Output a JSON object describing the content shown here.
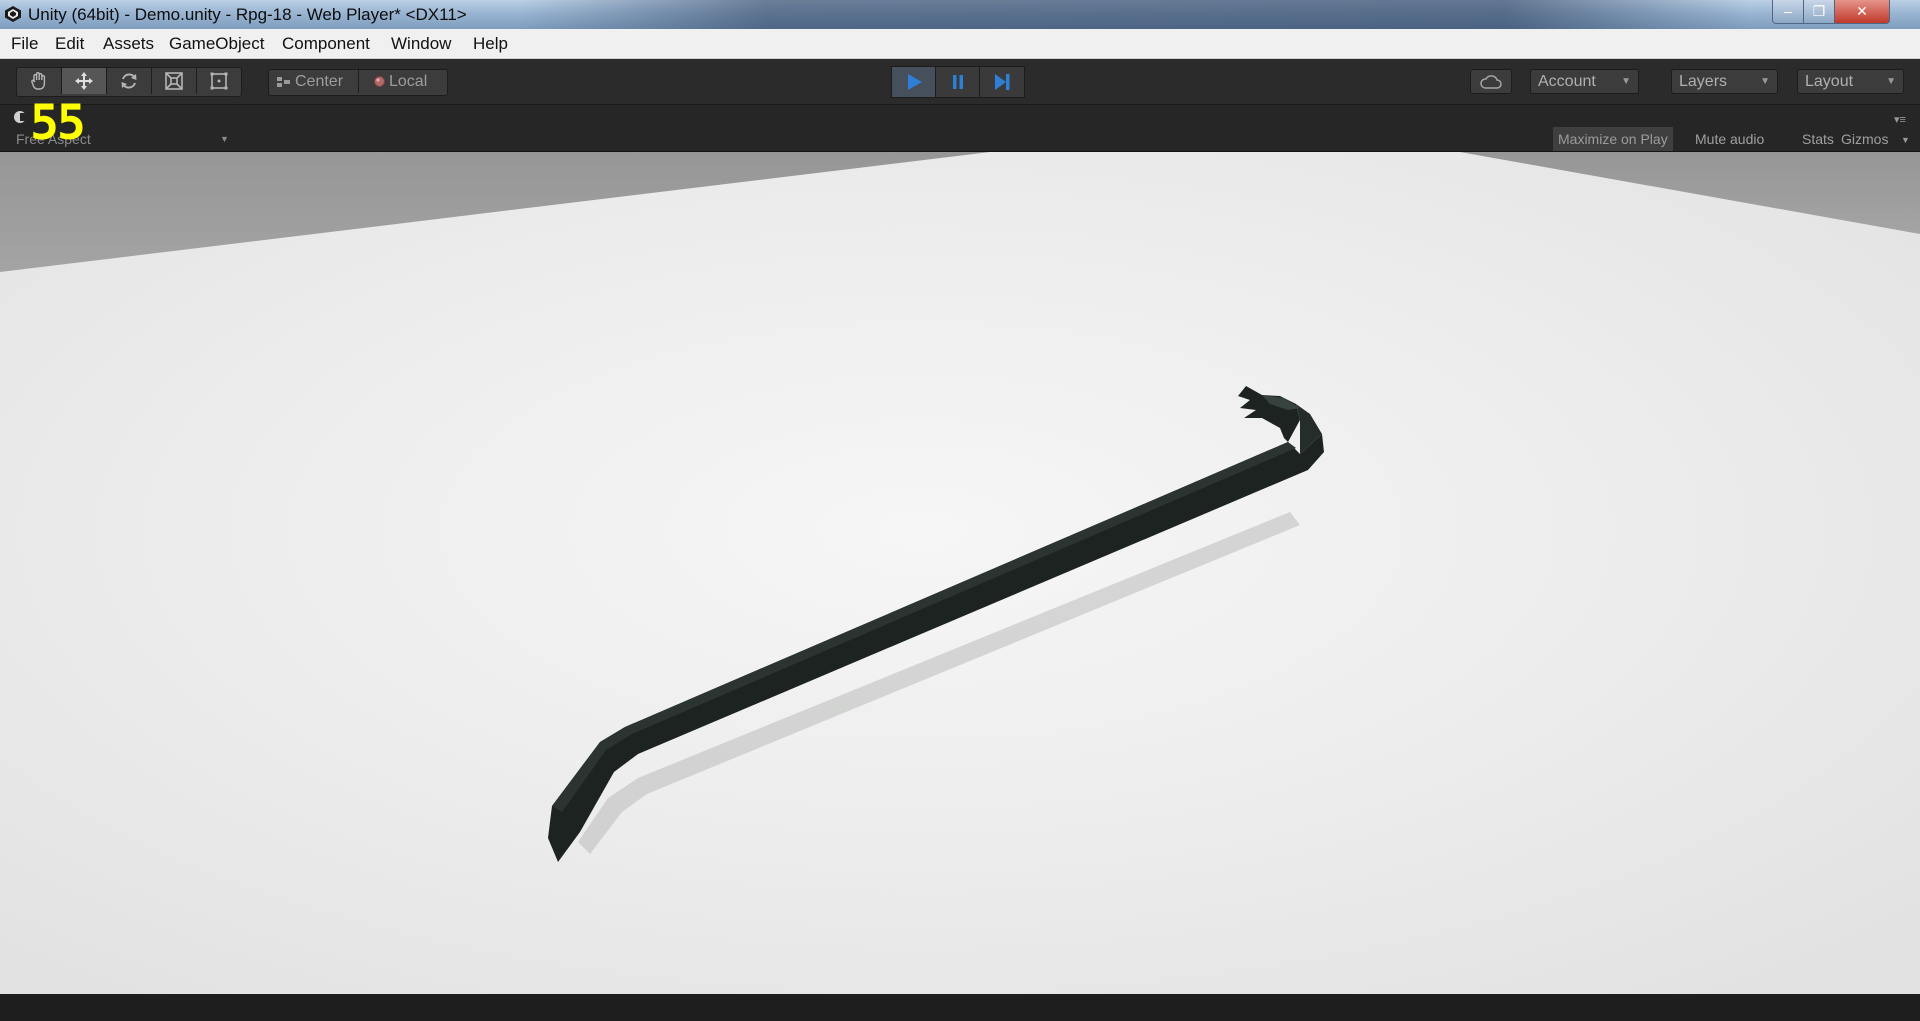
{
  "window": {
    "title": "Unity (64bit) - Demo.unity - Rpg-18 - Web Player* <DX11>",
    "controls": {
      "minimize": "–",
      "maximize": "❐",
      "close": "✕"
    }
  },
  "menu": [
    "File",
    "Edit",
    "Assets",
    "GameObject",
    "Component",
    "Window",
    "Help"
  ],
  "toolbar": {
    "transform_tools": [
      "hand-icon",
      "move-icon",
      "rotate-icon",
      "scale-icon",
      "rect-icon"
    ],
    "active_tool": "move-icon",
    "pivot": "Center",
    "space": "Local",
    "play_controls": [
      "play-icon",
      "pause-icon",
      "step-icon"
    ],
    "play_active": true,
    "account": "Account",
    "layers": "Layers",
    "layout": "Layout",
    "cloud_icon": "cloud-icon"
  },
  "game_view": {
    "fps": "55",
    "aspect": "Free Aspect",
    "options": [
      "Maximize on Play",
      "Mute audio",
      "Stats",
      "Gizmos"
    ]
  },
  "colors": {
    "accent": "#2f7fd6",
    "fps": "#ffff00",
    "floor": "#f0f0f0",
    "sky": "#9e9e9e",
    "object": "#1d2321"
  }
}
